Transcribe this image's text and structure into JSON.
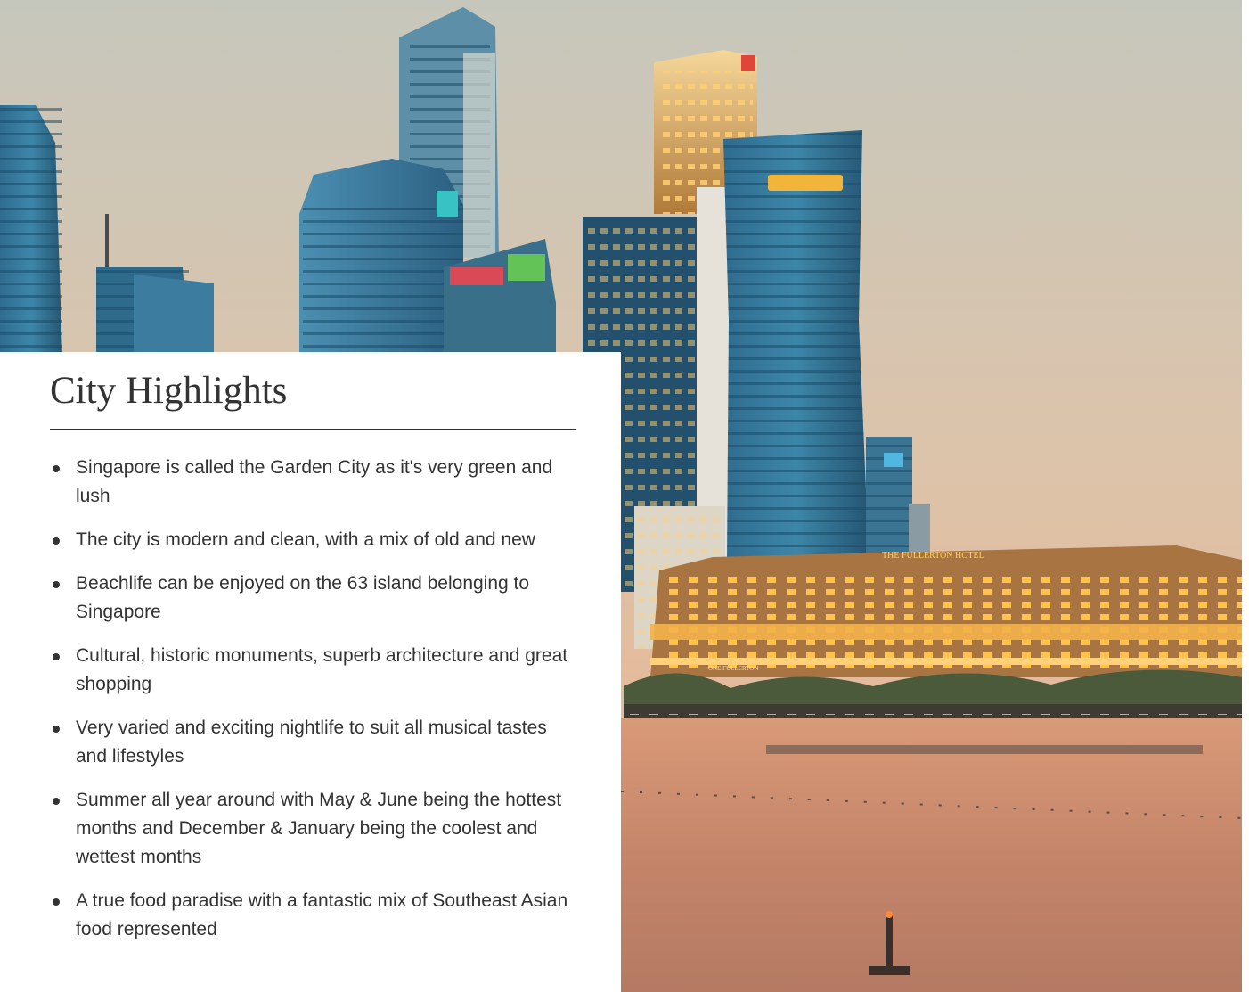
{
  "hero": {
    "image_icon": "singapore-skyline-photo",
    "hotel_sign": "THE FULLERTON HOTEL",
    "pier_sign": "ONE FULLERTON"
  },
  "card": {
    "title": "City Highlights",
    "items": [
      "Singapore is called the Garden City as it's very green and lush",
      "The city is modern and clean, with a mix of old and new",
      "Beachlife can be enjoyed on the 63 island belonging to Singapore",
      "Cultural, historic monuments, superb architecture and great shopping",
      "Very varied and exciting nightlife to suit all musical tastes and lifestyles",
      "Summer all year around with May & June being the hottest months and December & January being the coolest and wettest months",
      "A true food paradise with a fantastic mix of Southeast Asian food represented"
    ]
  },
  "colors": {
    "text": "#333333",
    "card_bg": "#ffffff",
    "sky_top": "#c9c9bd",
    "sky_bottom": "#e9b08a",
    "water": "#c7876a",
    "lights": "#ffb84a"
  }
}
